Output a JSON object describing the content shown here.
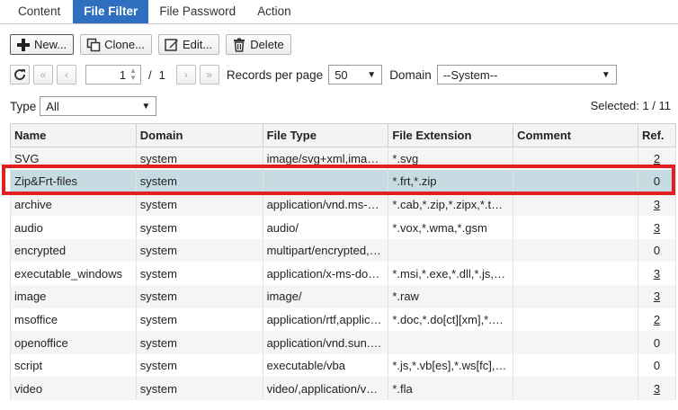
{
  "tabs": [
    {
      "label": "Content",
      "active": false
    },
    {
      "label": "File Filter",
      "active": true
    },
    {
      "label": "File Password",
      "active": false
    },
    {
      "label": "Action",
      "active": false
    }
  ],
  "toolbar": {
    "new_label": "New...",
    "clone_label": "Clone...",
    "edit_label": "Edit...",
    "delete_label": "Delete"
  },
  "pager": {
    "current_page": "1",
    "total_pages": "1",
    "records_label": "Records per page",
    "records_value": "50",
    "domain_label": "Domain",
    "domain_value": "--System--"
  },
  "filter": {
    "type_label": "Type",
    "type_value": "All",
    "selected_text": "Selected: 1 / 11"
  },
  "table": {
    "columns": [
      "Name",
      "Domain",
      "File Type",
      "File Extension",
      "Comment",
      "Ref."
    ],
    "rows": [
      {
        "name": "SVG",
        "domain": "system",
        "file_type": "image/svg+xml,image/svg-xml",
        "file_ext": "*.svg",
        "comment": "",
        "ref": "2",
        "ref_link": true
      },
      {
        "name": "Zip&Frt-files",
        "domain": "system",
        "file_type": "",
        "file_ext": "*.frt,*.zip",
        "comment": "",
        "ref": "0",
        "ref_link": false,
        "selected": true
      },
      {
        "name": "archive",
        "domain": "system",
        "file_type": "application/vnd.ms-cab-compressed",
        "file_ext": "*.cab,*.zip,*.zipx,*.tar,*.rar",
        "comment": "",
        "ref": "3",
        "ref_link": true
      },
      {
        "name": "audio",
        "domain": "system",
        "file_type": "audio/",
        "file_ext": "*.vox,*.wma,*.gsm",
        "comment": "",
        "ref": "3",
        "ref_link": true
      },
      {
        "name": "encrypted",
        "domain": "system",
        "file_type": "multipart/encrypted,application",
        "file_ext": "",
        "comment": "",
        "ref": "0",
        "ref_link": false
      },
      {
        "name": "executable_windows",
        "domain": "system",
        "file_type": "application/x-ms-dos-executable",
        "file_ext": "*.msi,*.exe,*.dll,*.js,*.jse,*.vbs",
        "comment": "",
        "ref": "3",
        "ref_link": true
      },
      {
        "name": "image",
        "domain": "system",
        "file_type": "image/",
        "file_ext": "*.raw",
        "comment": "",
        "ref": "3",
        "ref_link": true
      },
      {
        "name": "msoffice",
        "domain": "system",
        "file_type": "application/rtf,application/msword",
        "file_ext": "*.doc,*.do[ct][xm],*.xls,*.xlsx",
        "comment": "",
        "ref": "2",
        "ref_link": true
      },
      {
        "name": "openoffice",
        "domain": "system",
        "file_type": "application/vnd.sun.*,application",
        "file_ext": "",
        "comment": "",
        "ref": "0",
        "ref_link": false
      },
      {
        "name": "script",
        "domain": "system",
        "file_type": "executable/vba",
        "file_ext": "*.js,*.vb[es],*.ws[fc],*.java",
        "comment": "",
        "ref": "0",
        "ref_link": false
      },
      {
        "name": "video",
        "domain": "system",
        "file_type": "video/,application/vnd.rn-realmedia",
        "file_ext": "*.fla",
        "comment": "",
        "ref": "3",
        "ref_link": true
      }
    ]
  },
  "colors": {
    "active_tab": "#2f6fbf",
    "selected_row": "#c7dbe3",
    "highlight_box": "#e02020"
  }
}
